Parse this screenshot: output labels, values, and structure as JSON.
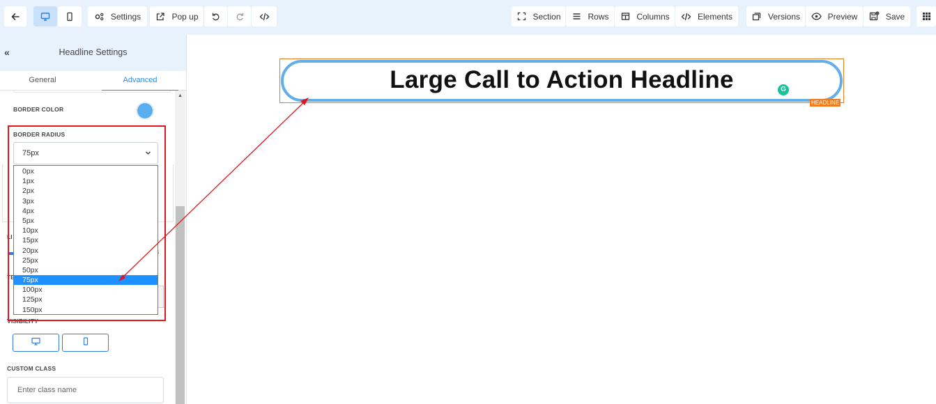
{
  "toolbar": {
    "back_icon": "arrow-left-icon",
    "desktop_icon": "desktop-icon",
    "mobile_icon": "mobile-icon",
    "settings_label": "Settings",
    "popup_label": "Pop up",
    "undo_icon": "undo-icon",
    "redo_icon": "redo-icon",
    "code_icon": "code-icon",
    "section_label": "Section",
    "rows_label": "Rows",
    "columns_label": "Columns",
    "elements_label": "Elements",
    "versions_label": "Versions",
    "preview_label": "Preview",
    "save_label": "Save",
    "apps_icon": "grid-icon"
  },
  "panel": {
    "title": "Headline Settings",
    "tabs": [
      {
        "label": "General",
        "active": false
      },
      {
        "label": "Advanced",
        "active": true
      }
    ],
    "border_color_label": "BORDER COLOR",
    "border_color_value": "#5aaef0",
    "border_radius_label": "BORDER RADIUS",
    "border_radius_value": "75px",
    "border_radius_options": [
      "0px",
      "1px",
      "2px",
      "3px",
      "4px",
      "5px",
      "10px",
      "15px",
      "20px",
      "25px",
      "50px",
      "75px",
      "100px",
      "125px",
      "150px"
    ],
    "peek_li": "LI",
    "peek_te": "TE",
    "peek_num": "8",
    "visibility_label": "VISIBILITY",
    "custom_class_label": "CUSTOM CLASS",
    "custom_class_placeholder": "Enter class name"
  },
  "canvas": {
    "headline_text": "Large Call to Action Headline",
    "element_tag": "HEADLINE",
    "grammarly_letter": "G"
  },
  "colors": {
    "accent": "#2f7be0",
    "toolbar_bg": "#e7f2fd",
    "selected_option": "#1e90ff",
    "highlight_box": "#e0161c",
    "element_outline": "#e47a1a",
    "headline_border": "#62aee8"
  }
}
